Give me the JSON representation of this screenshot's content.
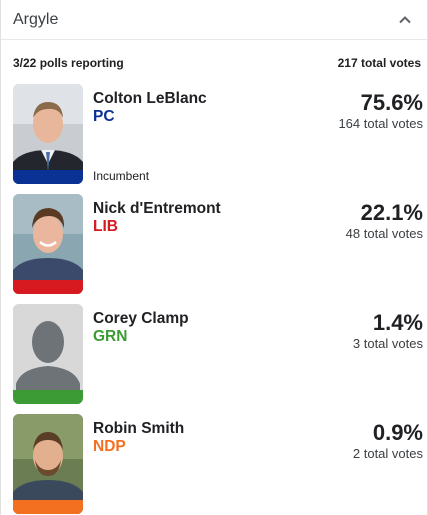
{
  "header": {
    "riding": "Argyle"
  },
  "summary": {
    "polls_reporting": "3/22 polls reporting",
    "total_votes": "217 total votes"
  },
  "candidates": [
    {
      "name": "Colton LeBlanc",
      "party": "PC",
      "party_color": "#0a3194",
      "pct": "75.6%",
      "votes": "164 total votes",
      "badge": "Incumbent",
      "photo": "candidate-photo"
    },
    {
      "name": "Nick d'Entremont",
      "party": "LIB",
      "party_color": "#d71920",
      "pct": "22.1%",
      "votes": "48 total votes",
      "badge": "",
      "photo": "candidate-photo"
    },
    {
      "name": "Corey Clamp",
      "party": "GRN",
      "party_color": "#3d9b35",
      "pct": "1.4%",
      "votes": "3 total votes",
      "badge": "",
      "photo": "placeholder-silhouette"
    },
    {
      "name": "Robin Smith",
      "party": "NDP",
      "party_color": "#f37021",
      "pct": "0.9%",
      "votes": "2 total votes",
      "badge": "",
      "photo": "candidate-photo"
    }
  ]
}
